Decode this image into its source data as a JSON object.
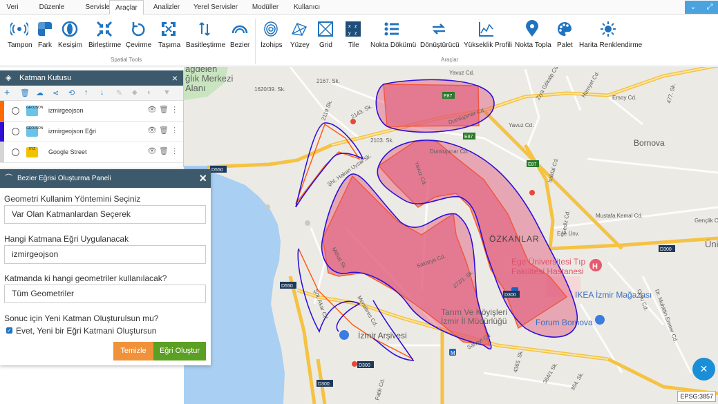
{
  "menu_tabs": [
    "Veri",
    "Düzenle",
    "Servisler",
    "Araçlar",
    "Analizler",
    "Yerel Servisler",
    "Modüller",
    "Kullanıcı"
  ],
  "active_tab": "Araçlar",
  "window_buttons": {
    "down": "⌄",
    "expand": "⤢"
  },
  "spatial_tools": [
    "Tampon",
    "Fark",
    "Kesişim",
    "Birleştirme",
    "Çevirme",
    "Taşıma",
    "Basitleştirme",
    "Bezier"
  ],
  "araclar_tools": [
    "İzohips",
    "Yüzey",
    "Grid",
    "Tile",
    "Nokta Dökümü",
    "Dönüştürücü",
    "Yükseklik Profili",
    "Nokta Topla",
    "Palet",
    "Harita Renklendirme"
  ],
  "tile_icon_text": {
    "top_left": "x",
    "top_right": "z",
    "bottom_left": "y",
    "bottom_right": "z"
  },
  "group_labels": {
    "spatial": "Spatial Tools",
    "araclar": "Araçlar"
  },
  "layer_panel": {
    "title": "Katman Kutusu",
    "layers": [
      {
        "name": "izmirgeojson",
        "color": "#ff6a00",
        "icon": "GEOJSON",
        "icon_bg": "#6cc3e8"
      },
      {
        "name": "izmirgeojson Eğri",
        "color": "#2f0fd6",
        "icon": "GEOJSON",
        "icon_bg": "#6cc3e8"
      },
      {
        "name": "Google Street",
        "color": "#d5d5d5",
        "icon": "XYZ",
        "icon_bg": "#f2c200"
      }
    ]
  },
  "bezier_panel": {
    "title": "Bezier Eğrisi Oluşturma Paneli",
    "q1_label": "Geometri Kullanim Yöntemini Seçiniz",
    "q1_value": "Var Olan Katmanlardan Seçerek",
    "q2_label": "Hangi Katmana Eğri Uygulanacak",
    "q2_value": "izmirgeojson",
    "q3_label": "Katmanda ki hangi geometriler kullanılacak?",
    "q3_value": "Tüm Geometriler",
    "q4_label": "Sonuc için Yeni Katman Oluşturulsun mu?",
    "checkbox_label": "Evet, Yeni bir Eğri Katmani Oluştursun",
    "checkbox_checked": true,
    "btn_clear": "Temizle",
    "btn_create": "Eğri Oluştur",
    "btn_clear_color": "#f0923a",
    "btn_create_color": "#5ba022"
  },
  "map": {
    "labels": {
      "dagdelen1": "ağdelen",
      "dagdelen2": "ğlık Merkezi",
      "alani": "Alanı",
      "st2167": "2167. Sk.",
      "st1620": "1620/39. Sk.",
      "st2119": "2119 Sk.",
      "st2143": "2143. Sk.",
      "st2103": "2103. Sk.",
      "hakan": "Şht. Hakan Uysal Sk.",
      "yavuz1": "Yavuz Cd.",
      "yavuz2": "Yavuz Cd.",
      "yavuz3": "Yavuz Cd.",
      "dumlupinar": "Dumlupınar Cd.",
      "dumlupinar2": "Dumlupınar Cd.",
      "ziya": "Ziya Gökalp Cd.",
      "huriyet": "Hürriyet Cd.",
      "ersoy": "Ersoy Cd.",
      "st477": "477. Sk.",
      "bornova": "Bornova",
      "istiklal": "İstiklal Cd.",
      "mustafa": "Mustafa Kemal Cd.",
      "genclik": "Gençlik Cd.",
      "gediz": "Gediz Cd.",
      "ozkanlar": "ÖZKANLAR",
      "ege_univ": "Ege Ünv.",
      "ege_tip1": "Ege Üniversitesi Tıp",
      "ege_tip2": "Fakültesi Hastanesi",
      "ikea": "IKEA İzmir Mağazası",
      "forum": "Forum Bornova",
      "tarim1": "Tarım Ve Köyişleri",
      "tarim2": "İzmir İl Müdürlüğü",
      "arsiv": "İzmir Arşivesi",
      "sakarya": "Sakarya Cd.",
      "mithat": "Mithat Sk.",
      "st373": "373/1. Sk.",
      "sanayi": "Sanayi Cd.",
      "menderes": "Menderes Cd.",
      "sht_akar": "Şht. Akar Cd.",
      "st4365": "4365. Sk.",
      "st3641": "364/1 Sk.",
      "st364": "364. Sk.",
      "fatih": "Fatih Cd.",
      "d550a": "D550",
      "d550b": "D550",
      "d300a": "D300",
      "d300b": "D300",
      "d300c": "D300",
      "d300d": "D300",
      "e87a": "E87",
      "e87b": "E87",
      "e87c": "E87",
      "ordu": "Ordu Cd.",
      "dr": "Dr. Muhittin Erener Cd.",
      "uni": "Üni",
      "m": "M"
    },
    "polygon_fill": "#e05577",
    "curve_stroke": "#2f0fd6",
    "polygon_stroke": "#ff5a1a"
  },
  "epsg": "EPSG:3857",
  "fab_icon": "tools-icon"
}
